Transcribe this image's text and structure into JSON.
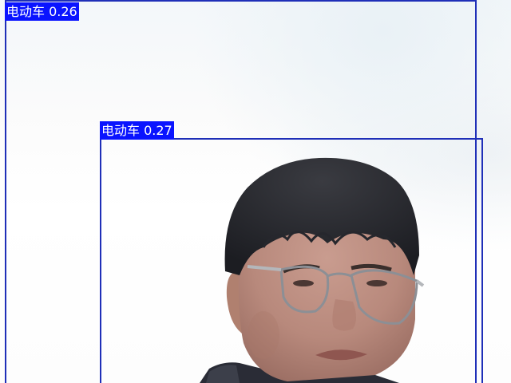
{
  "scene": {
    "subject": "person-with-glasses",
    "background_color": "#ffffff"
  },
  "detections": [
    {
      "label": "电动车 0.26",
      "class_name": "电动车",
      "confidence": 0.26,
      "color": "#1f2fb8"
    },
    {
      "label": "电动车 0.27",
      "class_name": "电动车",
      "confidence": 0.27,
      "color": "#1f2fb8"
    }
  ],
  "colors": {
    "box": "#1f2fb8",
    "label_background": "#0a14ff",
    "label_text": "#ffffff"
  }
}
